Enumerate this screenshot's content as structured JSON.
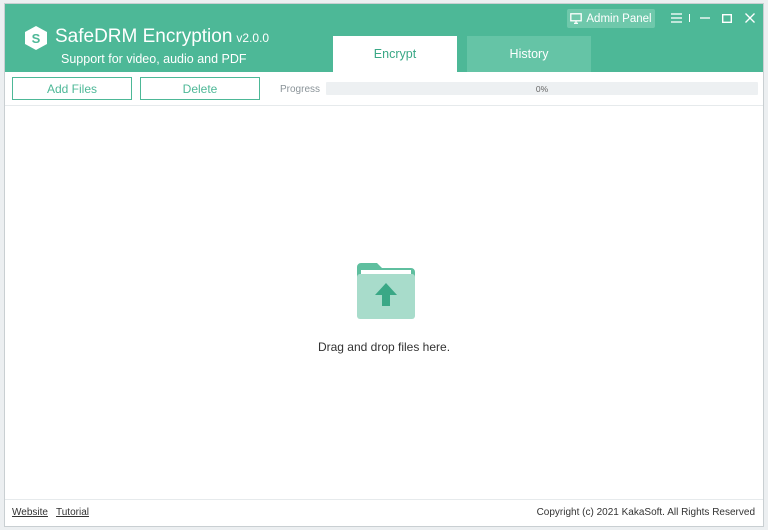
{
  "app": {
    "title": "SafeDRM Encryption",
    "version": "v2.0.0",
    "subtitle": "Support for video, audio and PDF"
  },
  "titlebar": {
    "admin_panel_label": "Admin Panel",
    "icons": [
      "monitor-icon",
      "menu-icon",
      "minimize-icon",
      "maximize-icon",
      "close-icon"
    ]
  },
  "tabs": [
    {
      "label": "Encrypt",
      "active": true
    },
    {
      "label": "History",
      "active": false
    }
  ],
  "toolbar": {
    "add_files_label": "Add Files",
    "delete_label": "Delete",
    "progress_label": "Progress",
    "progress_text": "0%",
    "progress_value": 0
  },
  "drop_zone": {
    "icon": "folder-upload-icon",
    "text": "Drag and drop files here."
  },
  "footer": {
    "website_label": "Website",
    "tutorial_label": "Tutorial",
    "copyright": "Copyright (c) 2021 KakaSoft. All Rights Reserved"
  },
  "colors": {
    "accent": "#4db897",
    "tab_inactive": "#65c4a6",
    "admin_button": "#6fc8ab",
    "folder_light": "#a8dccb",
    "folder_dark": "#5fbf9f",
    "arrow": "#3aa886"
  }
}
